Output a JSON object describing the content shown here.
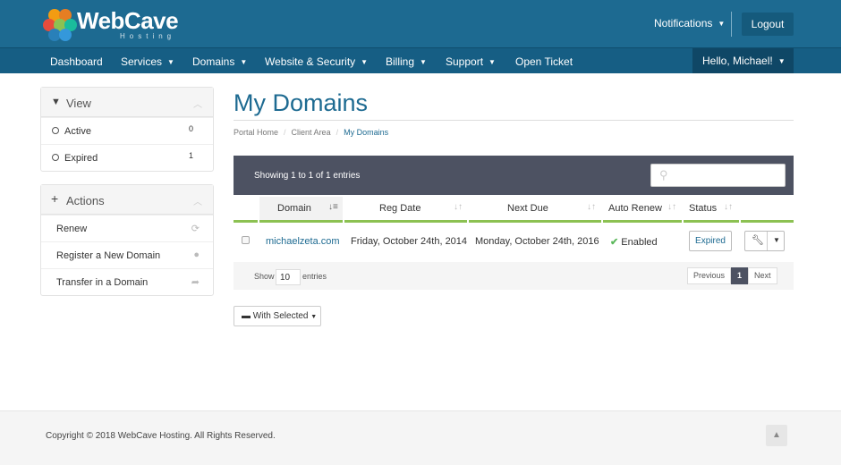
{
  "brand": {
    "name": "WebCave",
    "tagline": "Hosting"
  },
  "header": {
    "notifications": "Notifications",
    "logout": "Logout"
  },
  "nav": {
    "items": [
      {
        "label": "Dashboard",
        "dropdown": false
      },
      {
        "label": "Services",
        "dropdown": true
      },
      {
        "label": "Domains",
        "dropdown": true
      },
      {
        "label": "Website & Security",
        "dropdown": true
      },
      {
        "label": "Billing",
        "dropdown": true
      },
      {
        "label": "Support",
        "dropdown": true
      },
      {
        "label": "Open Ticket",
        "dropdown": false
      }
    ],
    "user": "Hello, Michael!"
  },
  "sidebar": {
    "view": {
      "title": "View",
      "items": [
        {
          "label": "Active",
          "count": "0"
        },
        {
          "label": "Expired",
          "count": "1"
        }
      ]
    },
    "actions": {
      "title": "Actions",
      "items": [
        {
          "label": "Renew",
          "icon": "refresh-icon"
        },
        {
          "label": "Register a New Domain",
          "icon": "globe-icon"
        },
        {
          "label": "Transfer in a Domain",
          "icon": "share-icon"
        }
      ]
    }
  },
  "page": {
    "title": "My Domains",
    "breadcrumb": [
      "Portal Home",
      "Client Area",
      "My Domains"
    ]
  },
  "table": {
    "info": "Showing 1 to 1 of 1 entries",
    "search_placeholder": "",
    "columns": [
      "Domain",
      "Reg Date",
      "Next Due",
      "Auto Renew",
      "Status"
    ],
    "rows": [
      {
        "domain": "michaelzeta.com",
        "reg_date": "Friday, October 24th, 2014",
        "next_due": "Monday, October 24th, 2016",
        "auto_renew": "Enabled",
        "status": "Expired"
      }
    ],
    "show_label": "Show",
    "page_size": "10",
    "entries_label": "entries",
    "pagination": {
      "previous": "Previous",
      "current": "1",
      "next": "Next"
    }
  },
  "with_selected": "With Selected",
  "footer": {
    "copyright": "Copyright © 2018 WebCave Hosting. All Rights Reserved."
  },
  "colors": {
    "primary": "#1d6a91",
    "nav": "#165e84",
    "accent_green": "#8cc152",
    "table_header": "#4d5262"
  }
}
